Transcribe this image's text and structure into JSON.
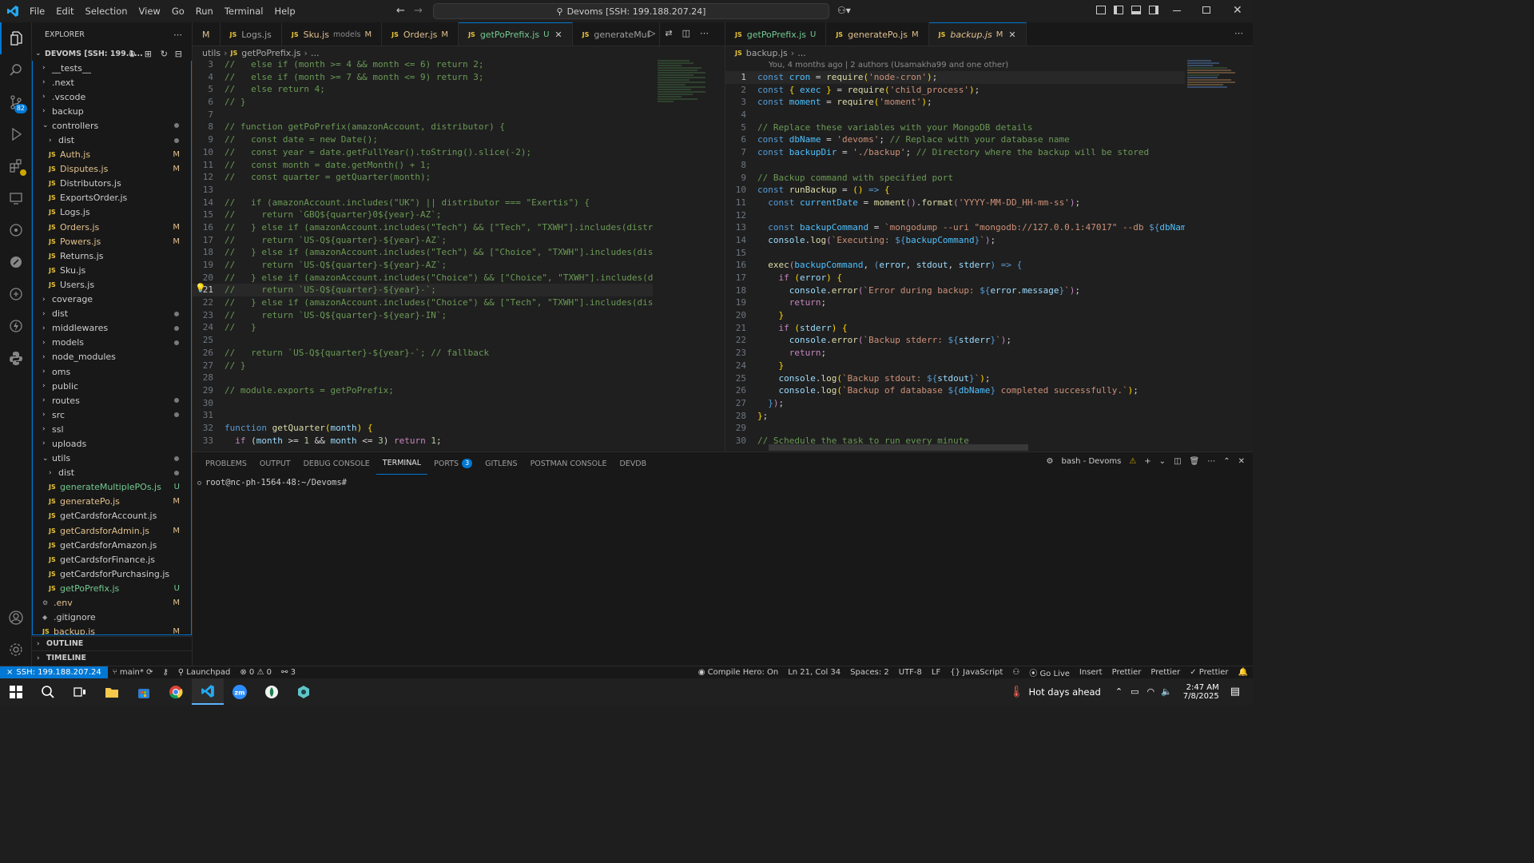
{
  "titlebar": {
    "menu": [
      "File",
      "Edit",
      "Selection",
      "View",
      "Go",
      "Run",
      "Terminal",
      "Help"
    ],
    "search": "Devoms [SSH: 199.188.207.24]"
  },
  "sidebar": {
    "title": "EXPLORER",
    "root": "DEVOMS [SSH: 199.1...",
    "items": [
      {
        "depth": 1,
        "type": "folder",
        "open": false,
        "name": "__tests__",
        "status": ""
      },
      {
        "depth": 1,
        "type": "folder",
        "open": false,
        "name": ".next",
        "status": ""
      },
      {
        "depth": 1,
        "type": "folder",
        "open": false,
        "name": ".vscode",
        "status": ""
      },
      {
        "depth": 1,
        "type": "folder",
        "open": false,
        "name": "backup",
        "status": ""
      },
      {
        "depth": 1,
        "type": "folder",
        "open": true,
        "name": "controllers",
        "status": "dot"
      },
      {
        "depth": 2,
        "type": "folder",
        "open": false,
        "name": "dist",
        "status": "dot"
      },
      {
        "depth": 2,
        "type": "file",
        "name": "Auth.js",
        "status": "M"
      },
      {
        "depth": 2,
        "type": "file",
        "name": "Disputes.js",
        "status": "M"
      },
      {
        "depth": 2,
        "type": "file",
        "name": "Distributors.js",
        "status": ""
      },
      {
        "depth": 2,
        "type": "file",
        "name": "ExportsOrder.js",
        "status": ""
      },
      {
        "depth": 2,
        "type": "file",
        "name": "Logs.js",
        "status": ""
      },
      {
        "depth": 2,
        "type": "file",
        "name": "Orders.js",
        "status": "M"
      },
      {
        "depth": 2,
        "type": "file",
        "name": "Powers.js",
        "status": "M"
      },
      {
        "depth": 2,
        "type": "file",
        "name": "Returns.js",
        "status": ""
      },
      {
        "depth": 2,
        "type": "file",
        "name": "Sku.js",
        "status": ""
      },
      {
        "depth": 2,
        "type": "file",
        "name": "Users.js",
        "status": ""
      },
      {
        "depth": 1,
        "type": "folder",
        "open": false,
        "name": "coverage",
        "status": ""
      },
      {
        "depth": 1,
        "type": "folder",
        "open": false,
        "name": "dist",
        "status": "dot"
      },
      {
        "depth": 1,
        "type": "folder",
        "open": false,
        "name": "middlewares",
        "status": "dot"
      },
      {
        "depth": 1,
        "type": "folder",
        "open": false,
        "name": "models",
        "status": "dot"
      },
      {
        "depth": 1,
        "type": "folder",
        "open": false,
        "name": "node_modules",
        "status": ""
      },
      {
        "depth": 1,
        "type": "folder",
        "open": false,
        "name": "oms",
        "status": ""
      },
      {
        "depth": 1,
        "type": "folder",
        "open": false,
        "name": "public",
        "status": ""
      },
      {
        "depth": 1,
        "type": "folder",
        "open": false,
        "name": "routes",
        "status": "dot"
      },
      {
        "depth": 1,
        "type": "folder",
        "open": false,
        "name": "src",
        "status": "dot"
      },
      {
        "depth": 1,
        "type": "folder",
        "open": false,
        "name": "ssl",
        "status": ""
      },
      {
        "depth": 1,
        "type": "folder",
        "open": false,
        "name": "uploads",
        "status": ""
      },
      {
        "depth": 1,
        "type": "folder",
        "open": true,
        "name": "utils",
        "status": "dot"
      },
      {
        "depth": 2,
        "type": "folder",
        "open": false,
        "name": "dist",
        "status": "dot"
      },
      {
        "depth": 2,
        "type": "file",
        "name": "generateMultiplePOs.js",
        "status": "U"
      },
      {
        "depth": 2,
        "type": "file",
        "name": "generatePo.js",
        "status": "M"
      },
      {
        "depth": 2,
        "type": "file",
        "name": "getCardsforAccount.js",
        "status": ""
      },
      {
        "depth": 2,
        "type": "file",
        "name": "getCardsforAdmin.js",
        "status": "M"
      },
      {
        "depth": 2,
        "type": "file",
        "name": "getCardsforAmazon.js",
        "status": ""
      },
      {
        "depth": 2,
        "type": "file",
        "name": "getCardsforFinance.js",
        "status": ""
      },
      {
        "depth": 2,
        "type": "file",
        "name": "getCardsforPurchasing.js",
        "status": ""
      },
      {
        "depth": 2,
        "type": "file",
        "name": "getPoPrefix.js",
        "status": "U"
      },
      {
        "depth": 1,
        "type": "env",
        "name": ".env",
        "status": "M"
      },
      {
        "depth": 1,
        "type": "git",
        "name": ".gitignore",
        "status": ""
      },
      {
        "depth": 1,
        "type": "file",
        "name": "backup.js",
        "status": "M"
      }
    ],
    "outline": "OUTLINE",
    "timeline": "TIMELINE"
  },
  "left_editor": {
    "tabs": [
      {
        "name": "M",
        "detail": "",
        "flag": "",
        "active": false,
        "partial": true
      },
      {
        "name": "Logs.js",
        "detail": "",
        "flag": "",
        "active": false
      },
      {
        "name": "Sku.js",
        "detail": "models",
        "flag": "M",
        "active": false
      },
      {
        "name": "Order.js",
        "detail": "",
        "flag": "M",
        "active": false
      },
      {
        "name": "getPoPrefix.js",
        "detail": "",
        "flag": "U",
        "active": true
      },
      {
        "name": "generateMul",
        "detail": "",
        "flag": "",
        "active": false
      }
    ],
    "breadcrumb": [
      "utils",
      "getPoPrefix.js",
      "..."
    ],
    "lines": [
      {
        "n": "3",
        "html": "<span class='cm'>//   else if (month >= 4 && month <= 6) return 2;</span>"
      },
      {
        "n": "4",
        "html": "<span class='cm'>//   else if (month >= 7 && month <= 9) return 3;</span>"
      },
      {
        "n": "5",
        "html": "<span class='cm'>//   else return 4;</span>"
      },
      {
        "n": "6",
        "html": "<span class='cm'>// }</span>"
      },
      {
        "n": "7",
        "html": ""
      },
      {
        "n": "8",
        "html": "<span class='cm'>// function getPoPrefix(amazonAccount, distributor) {</span>"
      },
      {
        "n": "9",
        "html": "<span class='cm'>//   const date = new Date();</span>"
      },
      {
        "n": "10",
        "html": "<span class='cm'>//   const year = date.getFullYear().toString().slice(-2);</span>"
      },
      {
        "n": "11",
        "html": "<span class='cm'>//   const month = date.getMonth() + 1;</span>"
      },
      {
        "n": "12",
        "html": "<span class='cm'>//   const quarter = getQuarter(month);</span>"
      },
      {
        "n": "13",
        "html": ""
      },
      {
        "n": "14",
        "html": "<span class='cm'>//   if (amazonAccount.includes(\"UK\") || distributor === \"Exertis\") {</span>"
      },
      {
        "n": "15",
        "html": "<span class='cm'>//     return `GBQ${quarter}0${year}-AZ`;</span>"
      },
      {
        "n": "16",
        "html": "<span class='cm'>//   } else if (amazonAccount.includes(\"Tech\") && [\"Tech\", \"TXWH\"].includes(distri</span>"
      },
      {
        "n": "17",
        "html": "<span class='cm'>//     return `US-Q${quarter}-${year}-AZ`;</span>"
      },
      {
        "n": "18",
        "html": "<span class='cm'>//   } else if (amazonAccount.includes(\"Tech\") && [\"Choice\", \"TXWH\"].includes(dist</span>"
      },
      {
        "n": "19",
        "html": "<span class='cm'>//     return `US-Q${quarter}-${year}-AZ`;</span>"
      },
      {
        "n": "20",
        "html": "<span class='cm'>//   } else if (amazonAccount.includes(\"Choice\") && [\"Choice\", \"TXWH\"].includes(di</span>"
      },
      {
        "n": "21",
        "html": "<span class='cm'>//     return `US-Q${quarter}-${year}-`;</span>",
        "current": true
      },
      {
        "n": "22",
        "html": "<span class='cm'>//   } else if (amazonAccount.includes(\"Choice\") && [\"Tech\", \"TXWH\"].includes(dist</span>"
      },
      {
        "n": "23",
        "html": "<span class='cm'>//     return `US-Q${quarter}-${year}-IN`;</span>"
      },
      {
        "n": "24",
        "html": "<span class='cm'>//   }</span>"
      },
      {
        "n": "25",
        "html": ""
      },
      {
        "n": "26",
        "html": "<span class='cm'>//   return `US-Q${quarter}-${year}-`; // fallback</span>"
      },
      {
        "n": "27",
        "html": "<span class='cm'>// }</span>"
      },
      {
        "n": "28",
        "html": ""
      },
      {
        "n": "29",
        "html": "<span class='cm'>// module.exports = getPoPrefix;</span>"
      },
      {
        "n": "30",
        "html": ""
      },
      {
        "n": "31",
        "html": ""
      },
      {
        "n": "32",
        "html": "<span class='kw'>function</span> <span class='fn'>getQuarter</span><span class='br'>(</span><span class='vr'>month</span><span class='br'>)</span> <span class='br'>{</span>"
      },
      {
        "n": "33",
        "html": "  <span class='kw2'>if</span> <span class='pl'>(</span><span class='vr'>month</span> <span class='pl'>&gt;=</span> <span class='num'>1</span> <span class='pl'>&amp;&amp;</span> <span class='vr'>month</span> <span class='pl'>&lt;=</span> <span class='num'>3</span><span class='pl'>)</span> <span class='kw2'>return</span> <span class='num'>1</span><span class='pl'>;</span>"
      }
    ]
  },
  "right_editor": {
    "tabs": [
      {
        "name": "getPoPrefix.js",
        "detail": "",
        "flag": "U",
        "active": false
      },
      {
        "name": "generatePo.js",
        "detail": "",
        "flag": "M",
        "active": false
      },
      {
        "name": "backup.js",
        "detail": "",
        "flag": "M",
        "active": true
      }
    ],
    "breadcrumb": [
      "backup.js",
      "..."
    ],
    "blame": "You, 4 months ago | 2 authors (Usamakha99 and one other)",
    "lines": [
      {
        "n": "1",
        "html": "<span class='kw'>const</span> <span class='cn'>cron</span> <span class='pl'>=</span> <span class='fn'>require</span><span class='br'>(</span><span class='str'>'node-cron'</span><span class='br'>)</span><span class='pl'>;</span>",
        "current": true
      },
      {
        "n": "2",
        "html": "<span class='kw'>const</span> <span class='br'>{</span> <span class='cn'>exec</span> <span class='br'>}</span> <span class='pl'>=</span> <span class='fn'>require</span><span class='br'>(</span><span class='str'>'child_process'</span><span class='br'>)</span><span class='pl'>;</span>"
      },
      {
        "n": "3",
        "html": "<span class='kw'>const</span> <span class='cn'>moment</span> <span class='pl'>=</span> <span class='fn'>require</span><span class='br'>(</span><span class='str'>'moment'</span><span class='br'>)</span><span class='pl'>;</span>"
      },
      {
        "n": "4",
        "html": ""
      },
      {
        "n": "5",
        "html": "<span class='cm'>// Replace these variables with your MongoDB details</span>"
      },
      {
        "n": "6",
        "html": "<span class='kw'>const</span> <span class='cn'>dbName</span> <span class='pl'>=</span> <span class='str'>'devoms'</span><span class='pl'>;</span> <span class='cm'>// Replace with your database name</span>"
      },
      {
        "n": "7",
        "html": "<span class='kw'>const</span> <span class='cn'>backupDir</span> <span class='pl'>=</span> <span class='str'>'./backup'</span><span class='pl'>;</span> <span class='cm'>// Directory where the backup will be stored</span>"
      },
      {
        "n": "8",
        "html": ""
      },
      {
        "n": "9",
        "html": "<span class='cm'>// Backup command with specified port</span>"
      },
      {
        "n": "10",
        "html": "<span class='kw'>const</span> <span class='fn'>runBackup</span> <span class='pl'>=</span> <span class='br'>()</span> <span class='kw'>=&gt;</span> <span class='br'>{</span>"
      },
      {
        "n": "11",
        "html": "  <span class='kw'>const</span> <span class='cn'>currentDate</span> <span class='pl'>=</span> <span class='fn'>moment</span><span class='kw2'>()</span><span class='pl'>.</span><span class='fn'>format</span><span class='kw2'>(</span><span class='str'>'YYYY-MM-DD_HH-mm-ss'</span><span class='kw2'>)</span><span class='pl'>;</span>"
      },
      {
        "n": "12",
        "html": ""
      },
      {
        "n": "13",
        "html": "  <span class='kw'>const</span> <span class='cn'>backupCommand</span> <span class='pl'>=</span> <span class='str'>`mongodump --uri \"mongodb://127.0.0.1:47017\" --db </span><span class='kw'>${</span><span class='cn'>dbName</span>"
      },
      {
        "n": "14",
        "html": "  <span class='vr'>console</span><span class='pl'>.</span><span class='fn'>log</span><span class='kw2'>(</span><span class='str'>`Executing: </span><span class='kw'>${</span><span class='cn'>backupCommand</span><span class='kw'>}</span><span class='str'>`</span><span class='kw2'>)</span><span class='pl'>;</span>"
      },
      {
        "n": "15",
        "html": ""
      },
      {
        "n": "16",
        "html": "  <span class='fn'>exec</span><span class='kw2'>(</span><span class='cn'>backupCommand</span><span class='pl'>,</span> <span class='kw'>(</span><span class='vr'>error</span><span class='pl'>,</span> <span class='vr'>stdout</span><span class='pl'>,</span> <span class='vr'>stderr</span><span class='kw'>)</span> <span class='kw'>=&gt;</span> <span class='kw'>{</span>"
      },
      {
        "n": "17",
        "html": "    <span class='kw2'>if</span> <span class='br'>(</span><span class='vr'>error</span><span class='br'>)</span> <span class='br'>{</span>"
      },
      {
        "n": "18",
        "html": "      <span class='vr'>console</span><span class='pl'>.</span><span class='fn'>error</span><span class='kw2'>(</span><span class='str'>`Error during backup: </span><span class='kw'>${</span><span class='vr'>error</span><span class='pl'>.</span><span class='vr'>message</span><span class='kw'>}</span><span class='str'>`</span><span class='kw2'>)</span><span class='pl'>;</span>"
      },
      {
        "n": "19",
        "html": "      <span class='kw2'>return</span><span class='pl'>;</span>"
      },
      {
        "n": "20",
        "html": "    <span class='br'>}</span>"
      },
      {
        "n": "21",
        "html": "    <span class='kw2'>if</span> <span class='br'>(</span><span class='vr'>stderr</span><span class='br'>)</span> <span class='br'>{</span>"
      },
      {
        "n": "22",
        "html": "      <span class='vr'>console</span><span class='pl'>.</span><span class='fn'>error</span><span class='kw2'>(</span><span class='str'>`Backup stderr: </span><span class='kw'>${</span><span class='vr'>stderr</span><span class='kw'>}</span><span class='str'>`</span><span class='kw2'>)</span><span class='pl'>;</span>"
      },
      {
        "n": "23",
        "html": "      <span class='kw2'>return</span><span class='pl'>;</span>"
      },
      {
        "n": "24",
        "html": "    <span class='br'>}</span>"
      },
      {
        "n": "25",
        "html": "    <span class='vr'>console</span><span class='pl'>.</span><span class='fn'>log</span><span class='br'>(</span><span class='str'>`Backup stdout: </span><span class='kw'>${</span><span class='vr'>stdout</span><span class='kw'>}</span><span class='str'>`</span><span class='br'>)</span><span class='pl'>;</span>"
      },
      {
        "n": "26",
        "html": "    <span class='vr'>console</span><span class='pl'>.</span><span class='fn'>log</span><span class='br'>(</span><span class='str'>`Backup of database </span><span class='kw'>${</span><span class='cn'>dbName</span><span class='kw'>}</span><span class='str'> completed successfully.`</span><span class='br'>)</span><span class='pl'>;</span>"
      },
      {
        "n": "27",
        "html": "  <span class='kw'>}</span><span class='kw2'>)</span><span class='pl'>;</span>"
      },
      {
        "n": "28",
        "html": "<span class='br'>}</span><span class='pl'>;</span>"
      },
      {
        "n": "29",
        "html": ""
      },
      {
        "n": "30",
        "html": "<span class='cm'>// Schedule the task to run every minute</span>"
      }
    ]
  },
  "panel": {
    "tabs": [
      "PROBLEMS",
      "OUTPUT",
      "DEBUG CONSOLE",
      "TERMINAL",
      "PORTS",
      "GITLENS",
      "POSTMAN CONSOLE",
      "DEVDB"
    ],
    "active_tab": "TERMINAL",
    "ports_badge": "3",
    "shell": "bash - Devoms",
    "prompt": "root@nc-ph-1564-48:~/Devoms#"
  },
  "activity": {
    "source_control_badge": "82"
  },
  "statusbar": {
    "remote": "SSH: 199.188.207.24",
    "branch": "main*",
    "launchpad": "Launchpad",
    "errors": "0",
    "warnings": "0",
    "ports": "3",
    "compile": "Compile Hero: On",
    "position": "Ln 21, Col 34",
    "spaces": "Spaces: 2",
    "encoding": "UTF-8",
    "eol": "LF",
    "language": "JavaScript",
    "golive": "Go Live",
    "insert": "Insert",
    "prettier1": "Prettier",
    "prettier2": "Prettier",
    "prettier3": "Prettier"
  },
  "taskbar": {
    "weather": "Hot days ahead",
    "time": "2:47 AM",
    "date": "7/8/2025"
  },
  "colors": {
    "accent": "#0078d4",
    "modified": "#e2c08d",
    "untracked": "#73c991"
  }
}
